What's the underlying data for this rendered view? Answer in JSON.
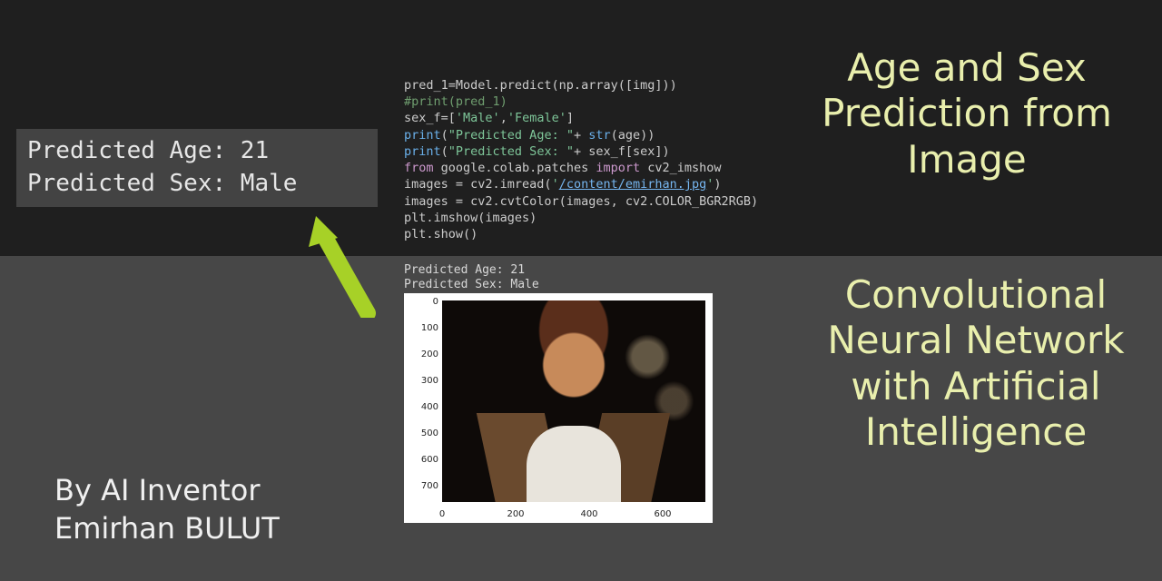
{
  "callout": {
    "line1": "Predicted Age: 21",
    "line2": "Predicted Sex: Male"
  },
  "code": {
    "l1a": "pred_1=Model.predict(np.array([img]))",
    "l2a": "#print(pred_1)",
    "l3a": "sex_f=[",
    "l3b": "'Male'",
    "l3c": ",",
    "l3d": "'Female'",
    "l3e": "]",
    "l4a": "print",
    "l4b": "(",
    "l4c": "\"Predicted Age: \"",
    "l4d": "+ ",
    "l4e": "str",
    "l4f": "(age))",
    "l5a": "print",
    "l5b": "(",
    "l5c": "\"Predicted Sex: \"",
    "l5d": "+ sex_f[sex])",
    "l6a": "from",
    "l6b": " google.colab.patches ",
    "l6c": "import",
    "l6d": " cv2_imshow",
    "l7a": "images = cv2.imread(",
    "l7b": "'",
    "l7c": "/content/emirhan.jpg",
    "l7d": "'",
    "l7e": ")",
    "l8a": "images = cv2.cvtColor(images, cv2.COLOR_BGR2RGB)",
    "l9a": "plt.imshow(images)",
    "l10a": "plt.show()"
  },
  "output": {
    "line1": "Predicted Age: 21",
    "line2": "Predicted Sex: Male"
  },
  "chart_data": {
    "type": "heatmap",
    "title": "",
    "xlabel": "",
    "ylabel": "",
    "xlim": [
      0,
      720
    ],
    "ylim": [
      720,
      0
    ],
    "x_ticks": [
      0,
      200,
      400,
      600
    ],
    "y_ticks": [
      0,
      100,
      200,
      300,
      400,
      500,
      600,
      700
    ],
    "note": "RGB image displayed via plt.imshow; portrait photo of a person"
  },
  "headline1": "Age and Sex Prediction from Image",
  "headline2": "Convolutional Neural Network with Artificial Intelligence",
  "byline": "By AI Inventor Emirhan BULUT"
}
